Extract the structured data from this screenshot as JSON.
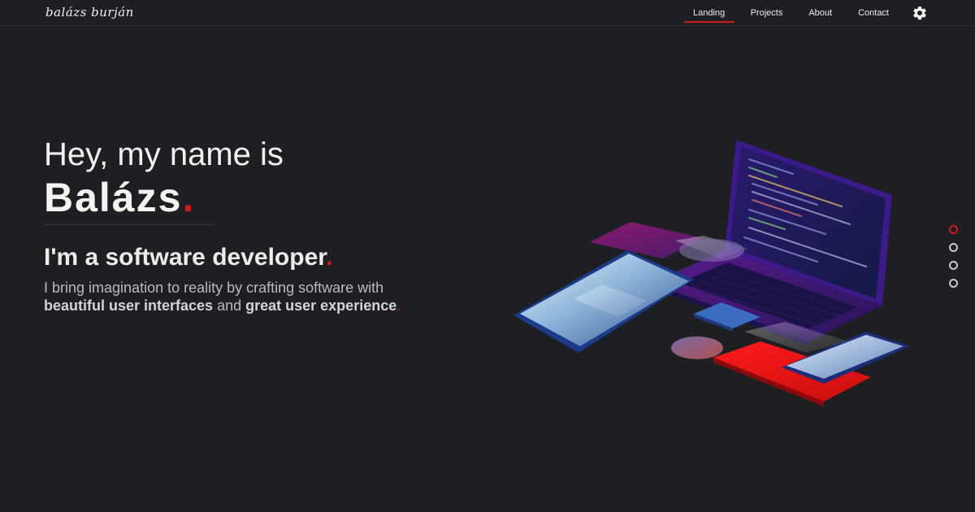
{
  "header": {
    "logo": "balázs burján",
    "nav": [
      "Landing",
      "Projects",
      "About",
      "Contact"
    ],
    "active_nav": "Landing",
    "settings_icon": "gear-icon"
  },
  "hero": {
    "greeting": "Hey, my name is",
    "name": "Balázs",
    "role_prefix": "I'm a ",
    "role_bold": "software developer",
    "desc_part1": "I bring imagination to reality by crafting software with ",
    "desc_bold1": "beautiful user interfaces",
    "desc_part2": " and ",
    "desc_bold2": "great user experience",
    "dot": "."
  },
  "pager": {
    "count": 4,
    "active_index": 0
  },
  "colors": {
    "background": "#1e1f22",
    "accent": "#d11a1a",
    "text": "#f1f1f1",
    "muted": "#b9bac4"
  }
}
